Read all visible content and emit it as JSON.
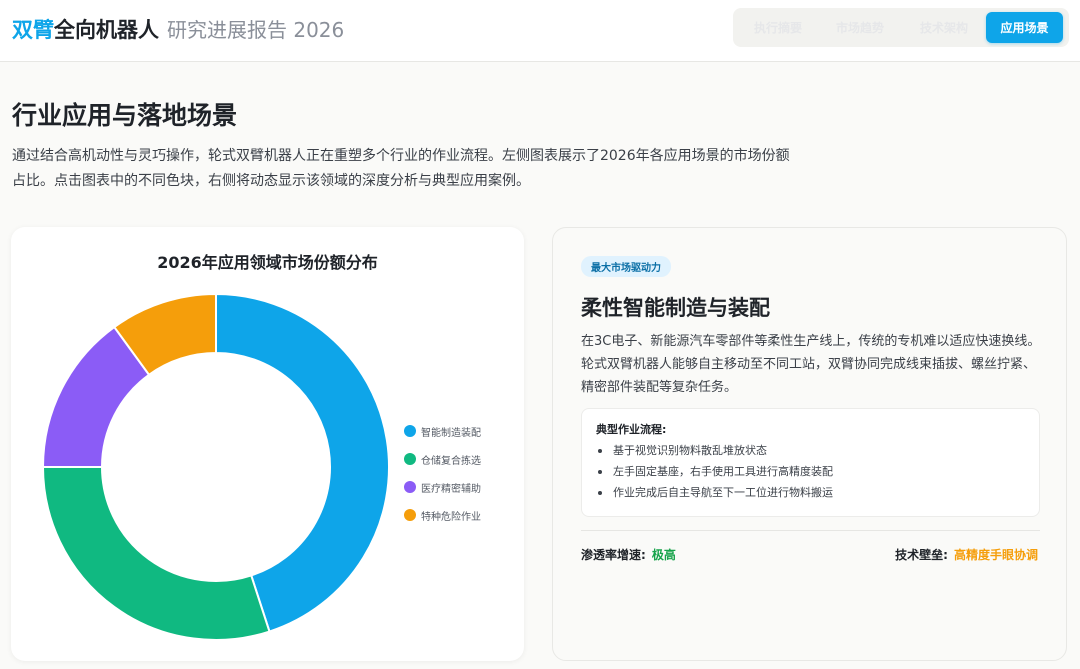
{
  "header": {
    "brand_accent": "双臂",
    "brand_main": "全向机器人",
    "brand_sub": "研究进展报告 2026",
    "tabs": [
      {
        "label": "执行摘要"
      },
      {
        "label": "市场趋势"
      },
      {
        "label": "技术架构"
      },
      {
        "label": "应用场景"
      }
    ],
    "active_tab": "应用场景"
  },
  "section": {
    "title": "行业应用与落地场景",
    "intro": "通过结合高机动性与灵巧操作，轮式双臂机器人正在重塑多个行业的作业流程。左侧图表展示了2026年各应用场景的市场份额占比。点击图表中的不同色块，右侧将动态显示该领域的深度分析与典型应用案例。"
  },
  "chart_data": {
    "type": "pie",
    "title": "2026年应用领域市场份额分布",
    "donut": true,
    "legend_position": "right",
    "categories": [
      "智能制造装配",
      "仓储复合拣选",
      "医疗精密辅助",
      "特种危险作业"
    ],
    "values": [
      45,
      30,
      15,
      10
    ],
    "colors": [
      "#0ea5e9",
      "#10b981",
      "#8b5cf6",
      "#f59e0b"
    ]
  },
  "detail": {
    "badge": "最大市场驱动力",
    "title": "柔性智能制造与装配",
    "description": "在3C电子、新能源汽车零部件等柔性生产线上，传统的专机难以适应快速换线。轮式双臂机器人能够自主移动至不同工站，双臂协同完成线束插拔、螺丝拧紧、精密部件装配等复杂任务。",
    "workflow_title": "典型作业流程:",
    "workflow_steps": [
      "基于视觉识别物料散乱堆放状态",
      "左手固定基座，右手使用工具进行高精度装配",
      "作业完成后自主导航至下一工位进行物料搬运"
    ],
    "metric_left_label": "渗透率增速:",
    "metric_left_value": "极高",
    "metric_right_label": "技术壁垒:",
    "metric_right_value": "高精度手眼协调"
  }
}
